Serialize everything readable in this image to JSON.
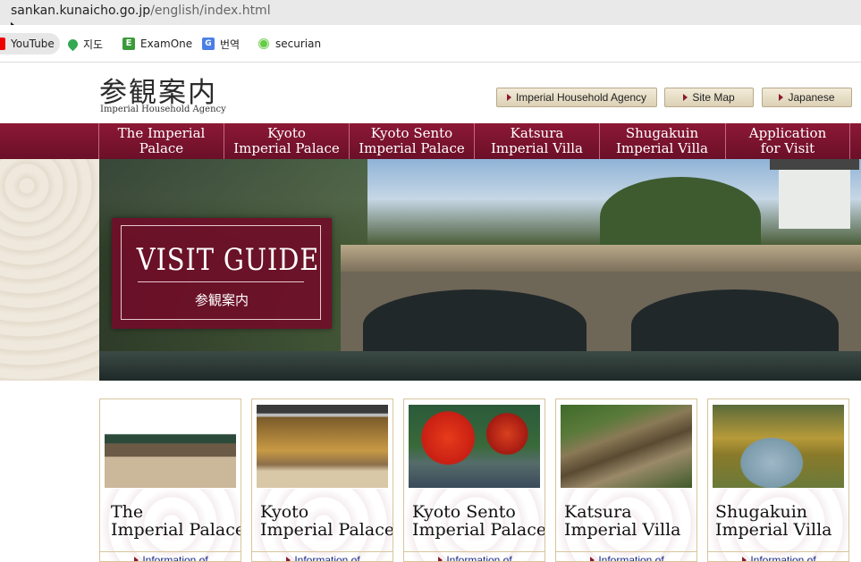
{
  "browser": {
    "url_host": "sankan.kunaicho.go.jp",
    "url_path": "/english/index.html",
    "bookmarks": [
      {
        "label": "YouTube",
        "icon": "youtube-icon"
      },
      {
        "label": "지도",
        "icon": "maps-icon"
      },
      {
        "label": "ExamOne",
        "icon": "examone-icon"
      },
      {
        "label": "번역",
        "icon": "translate-icon"
      },
      {
        "label": "securian",
        "icon": "securian-icon"
      }
    ]
  },
  "header": {
    "logo_jp": "参観案内",
    "logo_en": "Imperial Household Agency",
    "buttons": [
      "Imperial Household Agency",
      "Site Map",
      "Japanese"
    ]
  },
  "nav": [
    {
      "line1": "The Imperial",
      "line2": "Palace"
    },
    {
      "line1": "Kyoto",
      "line2": "Imperial Palace"
    },
    {
      "line1": "Kyoto Sento",
      "line2": "Imperial Palace"
    },
    {
      "line1": "Katsura",
      "line2": "Imperial Villa"
    },
    {
      "line1": "Shugakuin",
      "line2": "Imperial Villa"
    },
    {
      "line1": "Application",
      "line2": "for Visit"
    }
  ],
  "hero": {
    "title": "VISIT GUIDE",
    "subtitle": "参観案内"
  },
  "cards": [
    {
      "line1": "The",
      "line2": "Imperial Palace",
      "info": "Information of"
    },
    {
      "line1": "Kyoto",
      "line2": "Imperial Palace",
      "info": "Information of"
    },
    {
      "line1": "Kyoto Sento",
      "line2": "Imperial Palace",
      "info": "Information of"
    },
    {
      "line1": "Katsura",
      "line2": "Imperial Villa",
      "info": "Information of"
    },
    {
      "line1": "Shugakuin",
      "line2": "Imperial Villa",
      "info": "Information of"
    }
  ],
  "colors": {
    "nav_bg": "#7a1230",
    "accent": "#8a1a2e",
    "card_border": "#d8c59a",
    "link": "#1a2a8a"
  }
}
